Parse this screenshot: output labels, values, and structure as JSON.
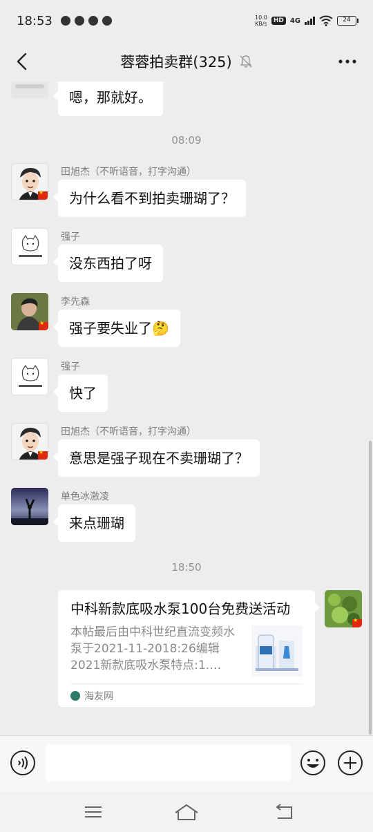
{
  "status_bar": {
    "time": "18:53",
    "net_speed": "10.0",
    "net_unit": "KB/s",
    "hd": "HD",
    "network": "4G",
    "battery": "24"
  },
  "header": {
    "title": "蓉蓉拍卖群(325)"
  },
  "messages": [
    {
      "text": "嗯，那就好。"
    },
    {
      "sender": "田旭杰（不听语音，打字沟通）",
      "text": "为什么看不到拍卖珊瑚了？"
    },
    {
      "sender": "强子",
      "text": "没东西拍了呀"
    },
    {
      "sender": "李先森",
      "text": "强子要失业了🤔"
    },
    {
      "sender": "强子",
      "text": "快了"
    },
    {
      "sender": "田旭杰（不听语音，打字沟通）",
      "text": "意思是强子现在不卖珊瑚了？"
    },
    {
      "sender": "单色冰激凌",
      "text": "来点珊瑚"
    }
  ],
  "timestamps": [
    "08:09",
    "18:50"
  ],
  "shared_card": {
    "title": "中科新款底吸水泵100台免费送活动",
    "description": "本帖最后由中科世纪直流变频水泵于2021-11-2018:26编辑2021新款底吸水泵特点:1.…",
    "source": "海友网"
  },
  "input": {
    "placeholder": ""
  },
  "icons": {
    "back": "chevron-left-icon",
    "mute": "bell-off-icon",
    "more": "more-dots-icon",
    "voice": "voice-icon",
    "emoji": "emoji-icon",
    "plus": "plus-icon"
  },
  "colors": {
    "background": "#ededed",
    "bubble": "#ffffff",
    "meta_text": "#8f8f8f"
  }
}
